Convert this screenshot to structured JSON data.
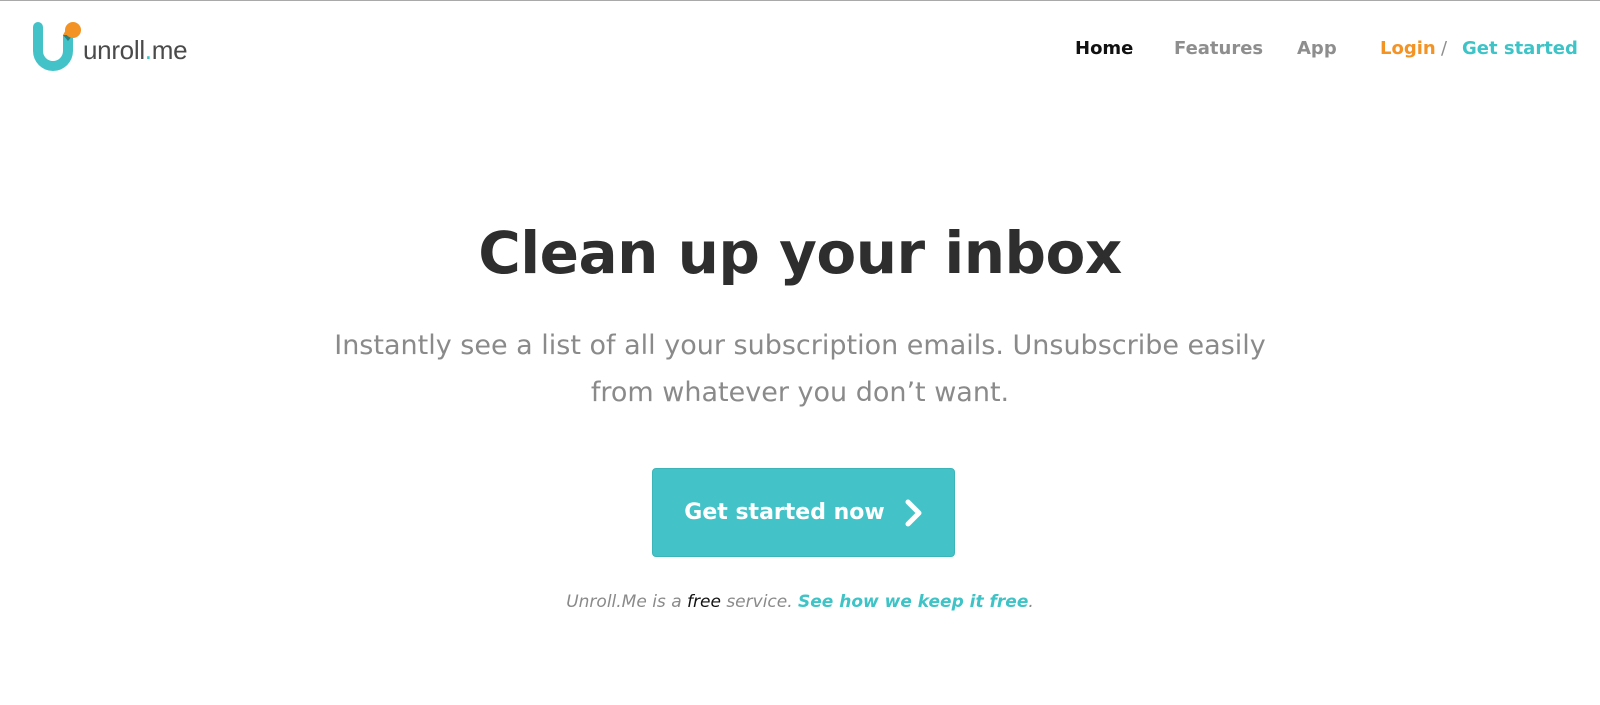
{
  "header": {
    "logo_text_main": "unroll",
    "logo_text_dot": ".",
    "logo_text_tld": "me",
    "nav": {
      "home": "Home",
      "features": "Features",
      "app": "App",
      "login": "Login",
      "separator": "/",
      "get_started": "Get started"
    }
  },
  "hero": {
    "title": "Clean up your inbox",
    "subtitle": "Instantly see a list of all your subscription emails. Unsubscribe easily from whatever you don’t want.",
    "cta_label": "Get started now",
    "note_prefix": "Unroll.Me is a ",
    "note_free": "free",
    "note_mid": " service. ",
    "note_link": "See how we keep it free",
    "note_suffix": "."
  },
  "colors": {
    "brand_teal": "#43c3c8",
    "brand_orange": "#f39325",
    "title_dark": "#2e2e2e",
    "muted_gray": "#8a8a8a"
  },
  "icons": {
    "logo": "unroll-me-logo-icon",
    "cta_chevron": "chevron-right-icon"
  }
}
